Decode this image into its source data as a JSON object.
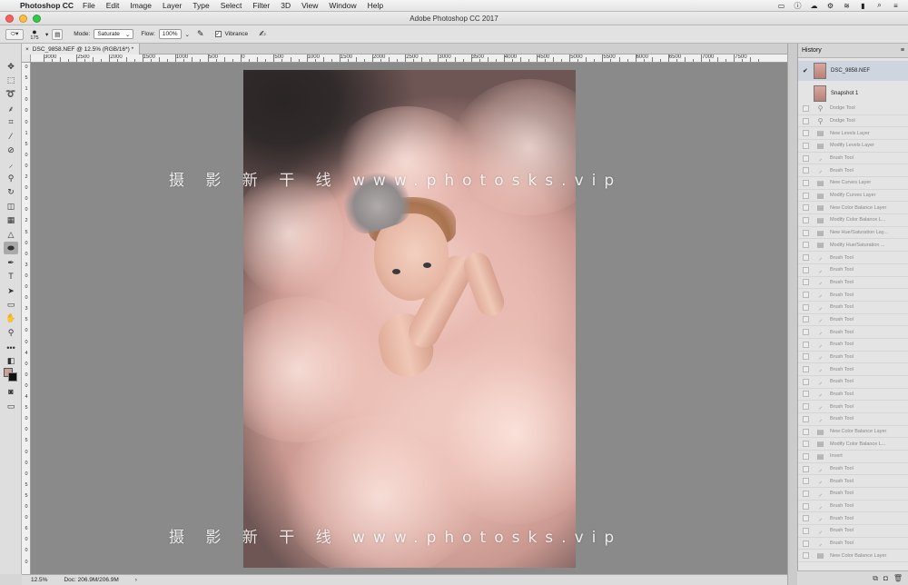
{
  "menubar": {
    "app_name": "Photoshop CC",
    "items": [
      "File",
      "Edit",
      "Image",
      "Layer",
      "Type",
      "Select",
      "Filter",
      "3D",
      "View",
      "Window",
      "Help"
    ]
  },
  "window": {
    "title": "Adobe Photoshop CC 2017"
  },
  "options_bar": {
    "brush_size": "175",
    "mode_label": "Mode:",
    "mode_value": "Saturate",
    "flow_label": "Flow:",
    "flow_value": "100%",
    "vibrance_label": "Vibrance",
    "vibrance_checked": true
  },
  "document": {
    "tab_title": "DSC_9858.NEF @ 12.5% (RGB/16*) *"
  },
  "ruler": {
    "h_ticks": [
      "3000",
      "2500",
      "2000",
      "1500",
      "1000",
      "500",
      "0",
      "500",
      "1000",
      "1500",
      "2000",
      "2500",
      "3000",
      "3500",
      "4000",
      "4500",
      "5000",
      "5500",
      "6000",
      "6500",
      "7000",
      "7500"
    ],
    "v_ticks": [
      "0",
      "5",
      "1",
      "0",
      "0",
      "0",
      "1",
      "5",
      "0",
      "0",
      "2",
      "0",
      "0",
      "0",
      "2",
      "5",
      "0",
      "0",
      "3",
      "0",
      "0",
      "0",
      "3",
      "5",
      "0",
      "0",
      "4",
      "0",
      "0",
      "0",
      "4",
      "5",
      "0",
      "0",
      "5",
      "0",
      "0",
      "0",
      "5",
      "5",
      "0",
      "0",
      "6",
      "0",
      "0",
      "0"
    ]
  },
  "watermark": {
    "top": "摄 影 新 干 线 www.photosks.vip",
    "bottom": "摄 影 新 干 线 www.photosks.vip"
  },
  "status": {
    "zoom": "12.5%",
    "doc_info": "Doc: 206.9M/206.9M"
  },
  "history_panel": {
    "tab_label": "History",
    "snapshots": [
      {
        "label": "DSC_9858.NEF",
        "selected": true
      },
      {
        "label": "Snapshot 1",
        "selected": false
      }
    ],
    "items": [
      {
        "label": "Dodge Tool",
        "icon": "dodge-icon"
      },
      {
        "label": "Dodge Tool",
        "icon": "dodge-icon"
      },
      {
        "label": "New Levels Layer",
        "icon": "layer-icon"
      },
      {
        "label": "Modify Levels Layer",
        "icon": "layer-icon"
      },
      {
        "label": "Brush Tool",
        "icon": "brush-icon"
      },
      {
        "label": "Brush Tool",
        "icon": "brush-icon"
      },
      {
        "label": "New Curves Layer",
        "icon": "layer-icon"
      },
      {
        "label": "Modify Curves Layer",
        "icon": "layer-icon"
      },
      {
        "label": "New Color Balance Layer",
        "icon": "layer-icon"
      },
      {
        "label": "Modify Color Balance L...",
        "icon": "layer-icon"
      },
      {
        "label": "New Hue/Saturation Lay...",
        "icon": "layer-icon"
      },
      {
        "label": "Modify Hue/Saturation ...",
        "icon": "layer-icon"
      },
      {
        "label": "Brush Tool",
        "icon": "brush-icon"
      },
      {
        "label": "Brush Tool",
        "icon": "brush-icon"
      },
      {
        "label": "Brush Tool",
        "icon": "brush-icon"
      },
      {
        "label": "Brush Tool",
        "icon": "brush-icon"
      },
      {
        "label": "Brush Tool",
        "icon": "brush-icon"
      },
      {
        "label": "Brush Tool",
        "icon": "brush-icon"
      },
      {
        "label": "Brush Tool",
        "icon": "brush-icon"
      },
      {
        "label": "Brush Tool",
        "icon": "brush-icon"
      },
      {
        "label": "Brush Tool",
        "icon": "brush-icon"
      },
      {
        "label": "Brush Tool",
        "icon": "brush-icon"
      },
      {
        "label": "Brush Tool",
        "icon": "brush-icon"
      },
      {
        "label": "Brush Tool",
        "icon": "brush-icon"
      },
      {
        "label": "Brush Tool",
        "icon": "brush-icon"
      },
      {
        "label": "Brush Tool",
        "icon": "brush-icon"
      },
      {
        "label": "New Color Balance Layer",
        "icon": "layer-icon"
      },
      {
        "label": "Modify Color Balance L...",
        "icon": "layer-icon"
      },
      {
        "label": "Invert",
        "icon": "layer-icon"
      },
      {
        "label": "Brush Tool",
        "icon": "brush-icon"
      },
      {
        "label": "Brush Tool",
        "icon": "brush-icon"
      },
      {
        "label": "Brush Tool",
        "icon": "brush-icon"
      },
      {
        "label": "Brush Tool",
        "icon": "brush-icon"
      },
      {
        "label": "Brush Tool",
        "icon": "brush-icon"
      },
      {
        "label": "Brush Tool",
        "icon": "brush-icon"
      },
      {
        "label": "Brush Tool",
        "icon": "brush-icon"
      },
      {
        "label": "New Color Balance Layer",
        "icon": "layer-icon"
      }
    ]
  },
  "colors": {
    "canvas_bg": "#8a8a8a",
    "foreground": "#c9a09c",
    "background": "#111111"
  }
}
